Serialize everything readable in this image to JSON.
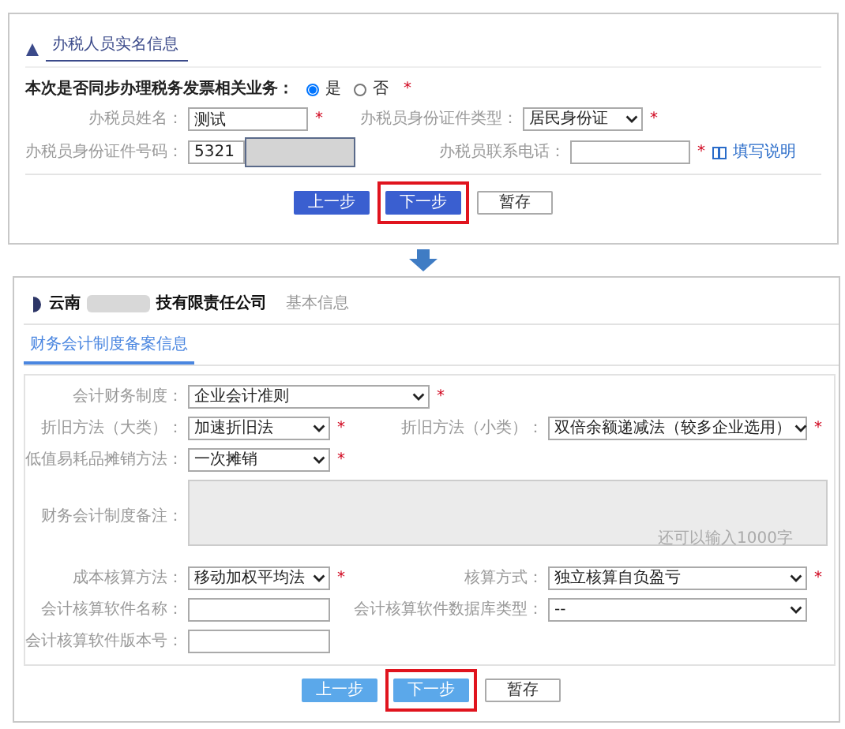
{
  "top_section": {
    "title": "办税人员实名信息",
    "question": {
      "label": "本次是否同步办理税务发票相关业务：",
      "mark": "*",
      "options": [
        {
          "label": "是",
          "selected": true
        },
        {
          "label": "否",
          "selected": false
        }
      ]
    },
    "rows": [
      [
        {
          "label": "办税员姓名：",
          "kind": "input",
          "value": "测试",
          "mark": "*"
        },
        {
          "label": "办税员身份证件类型：",
          "kind": "select",
          "value": "居民身份证",
          "mark": "*"
        }
      ],
      [
        {
          "label": "办税员身份证件号码：",
          "kind": "input",
          "value": "5321",
          "redacted": true
        },
        {
          "label": "办税员联系电话：",
          "kind": "input",
          "mark": "*",
          "link": "填写说明"
        }
      ]
    ],
    "buttons": [
      {
        "label": "上一步",
        "kind": "primary",
        "highlighted": false
      },
      {
        "label": "下一步",
        "kind": "primary",
        "highlighted": true
      },
      {
        "label": "暂存",
        "kind": "secondary",
        "highlighted": false
      }
    ]
  },
  "bottom_section": {
    "company_prefix": "云南",
    "company_suffix": "技有限责任公司",
    "subtitle": "基本信息",
    "tabs": [
      {
        "label": "财务会计制度备案信息",
        "selected": true
      }
    ],
    "rows": [
      [
        {
          "label": "会计财务制度：",
          "kind": "select",
          "value": "企业会计准则",
          "wide": true,
          "mark": "*"
        }
      ],
      [
        {
          "label": "折旧方法（大类）：",
          "kind": "select",
          "value": "加速折旧法",
          "mark": "*"
        },
        {
          "label": "折旧方法（小类）：",
          "kind": "select",
          "value": "双倍余额递减法（较多企业选用）",
          "mark": "*"
        }
      ],
      [
        {
          "label": "低值易耗品摊销方法：",
          "kind": "select",
          "value": "一次摊销",
          "mark": "*"
        }
      ],
      [
        {
          "label": "财务会计制度备注：",
          "kind": "textarea",
          "disabled": true,
          "counter": "还可以输入1000字"
        }
      ],
      [
        {
          "label": "成本核算方法：",
          "kind": "select",
          "value": "移动加权平均法",
          "mark": "*"
        },
        {
          "label": "核算方式：",
          "kind": "select",
          "value": "独立核算自负盈亏",
          "mark": "*"
        }
      ],
      [
        {
          "label": "会计核算软件名称：",
          "kind": "input"
        },
        {
          "label": "会计核算软件数据库类型：",
          "kind": "select",
          "value": "--"
        }
      ],
      [
        {
          "label": "会计核算软件版本号：",
          "kind": "input"
        }
      ]
    ],
    "buttons": [
      {
        "label": "上一步",
        "kind": "light",
        "highlighted": false
      },
      {
        "label": "下一步",
        "kind": "light",
        "highlighted": true
      },
      {
        "label": "暂存",
        "kind": "secondary",
        "highlighted": false
      }
    ]
  }
}
